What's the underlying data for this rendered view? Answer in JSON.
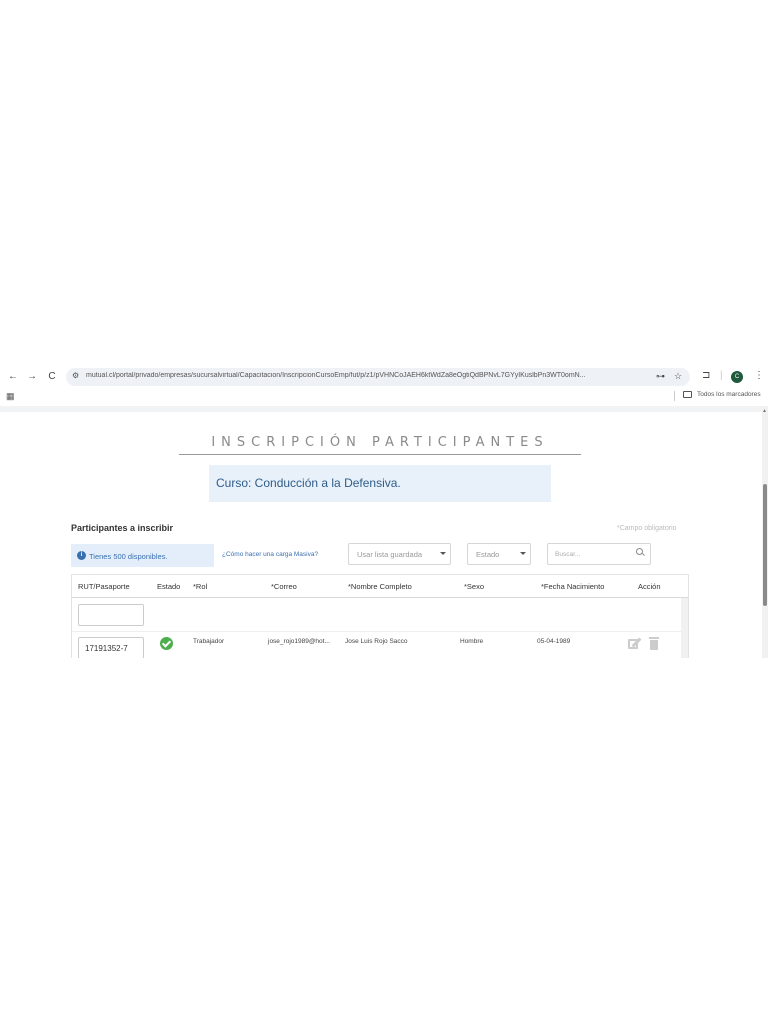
{
  "browser": {
    "back_icon": "←",
    "forward_icon": "→",
    "reload_icon": "C",
    "url": "mutual.cl/portal/privado/empresas/sucursalvirtual/Capacitacion/InscripcionCursoEmp/fut/p/z1/pVHNCoJAEH6ktWdZa8eOgtiQdBPNvL7GYyIKuslbPn3WT0omN...",
    "profile_initial": "C",
    "bookmarks_label": "Todos los marcadores"
  },
  "page": {
    "title": "INSCRIPCIÓN PARTICIPANTES",
    "course_label": "Curso: Conducción a la Defensiva."
  },
  "participants": {
    "section_title": "Participantes a inscribir",
    "required_note": "*Campo obligatorio",
    "available_text": "Tienes 500 disponibles.",
    "help_link": "¿Cómo hacer una carga Masiva?",
    "saved_list_placeholder": "Usar lista guardada",
    "status_placeholder": "Estado",
    "search_placeholder": "Buscar..."
  },
  "table": {
    "headers": [
      "RUT/Pasaporte",
      "Estado",
      "*Rol",
      "*Correo",
      "*Nombre Completo",
      "*Sexo",
      "*Fecha Nacimiento",
      "Acción"
    ],
    "rows": [
      {
        "rut": "17191352-7",
        "estado": "valid",
        "rol": "Trabajador",
        "correo": "jose_rojo1989@hot...",
        "nombre": "Jose Luis Rojo Sacco",
        "sexo": "Hombre",
        "fecha": "05-04-1989"
      }
    ]
  },
  "colors": {
    "accent": "#3a70b0",
    "course_bg": "#e8f1fa",
    "status_ok": "#4cae4c"
  }
}
